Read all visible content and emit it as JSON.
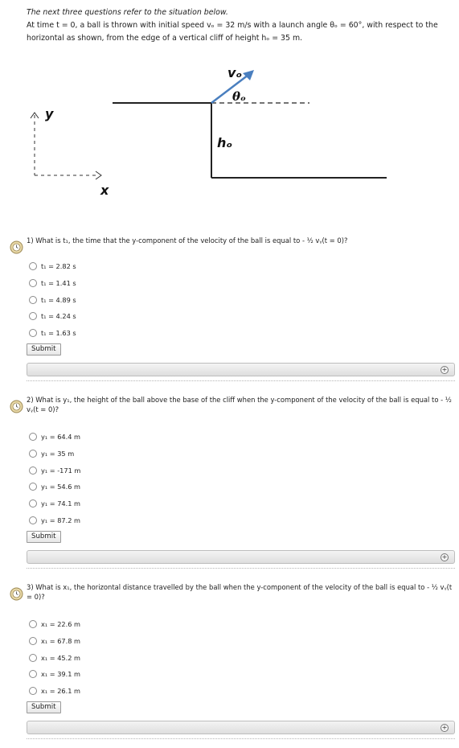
{
  "intro": {
    "heading": "The next three questions refer to the situation below.",
    "body": "At time t = 0, a ball is thrown with initial speed vₒ = 32 m/s with a launch angle θₒ = 60°, with respect to the horizontal as shown, from the edge of a vertical cliff of height hₒ = 35 m."
  },
  "diagram": {
    "axis_y": "y",
    "axis_x": "x",
    "velocity_label": "vₒ",
    "angle_label": "θₒ",
    "height_label": "hₒ",
    "arrow_color": "#4a7fbf"
  },
  "questions": [
    {
      "number_text": "1) What is t₁, the time that the y-component of the velocity of the ball is equal to - ½ vᵧ(t = 0)?",
      "options": [
        "t₁ = 2.82 s",
        "t₁ = 1.41 s",
        "t₁ = 4.89 s",
        "t₁ = 4.24 s",
        "t₁ = 1.63 s"
      ],
      "submit": "Submit"
    },
    {
      "number_text": "2) What is y₁, the height of the ball above the base of the cliff when the y-component of the velocity of the ball is equal to - ½ vᵧ(t = 0)?",
      "options": [
        "y₁ = 64.4 m",
        "y₁ = 35 m",
        "y₁ = -171 m",
        "y₁ = 54.6 m",
        "y₁ = 74.1 m",
        "y₁ = 87.2 m"
      ],
      "submit": "Submit"
    },
    {
      "number_text": "3) What is x₁, the horizontal distance travelled by the ball when the y-component of the velocity of the ball is equal to - ½ vᵧ(t = 0)?",
      "options": [
        "x₁ = 22.6 m",
        "x₁ = 67.8 m",
        "x₁ = 45.2 m",
        "x₁ = 39.1 m",
        "x₁ = 26.1 m"
      ],
      "submit": "Submit"
    }
  ],
  "feedback_toggle_symbol": "+"
}
